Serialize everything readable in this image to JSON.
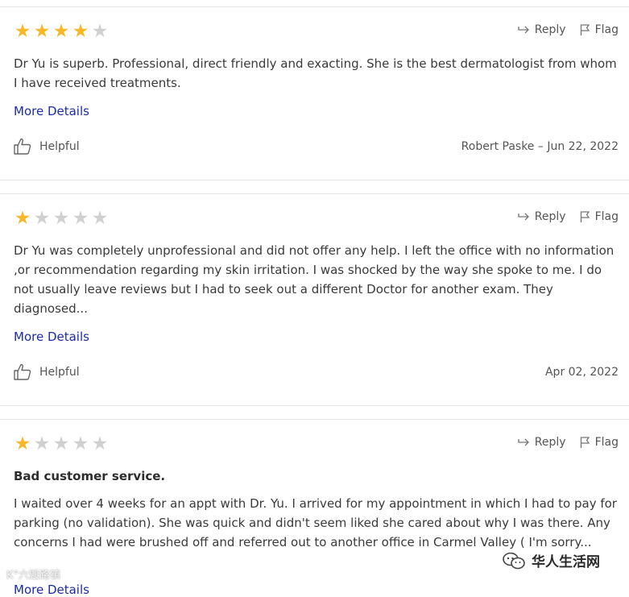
{
  "labels": {
    "reply": "Reply",
    "flag": "Flag",
    "more_details": "More Details",
    "helpful": "Helpful"
  },
  "colors": {
    "star_on": "#f7b92b",
    "star_off": "#d0d0d0",
    "link": "#1a2ca6"
  },
  "reviews": [
    {
      "rating": 4,
      "title": "",
      "text": "Dr Yu is superb. Professional, direct friendly and exacting. She is the best dermatologist from whom I have received treatments.",
      "author_date": "Robert Paske – Jun 22, 2022"
    },
    {
      "rating": 1,
      "title": "",
      "text": "Dr Yu was completely unprofessional and did not offer any help. I left the office with no information ,or recommendation regarding my skin irritation. I was shocked by the way she spoke to me. I do not usually leave reviews but I had to seek out a different Doctor for another exam. They diagnosed...",
      "author_date": "Apr 02, 2022"
    },
    {
      "rating": 1,
      "title": "Bad customer service.",
      "text": "I waited over 4 weeks for an appt with Dr. Yu. I arrived for my appointment in which I had to pay for parking (no validation). She was quick and didn't seem liked she cared about why I was there. Any concerns I had were brushed off and referred out to another office in Carmel Valley ( I'm sorry...",
      "author_date": ""
    }
  ],
  "watermarks": {
    "left": "K°六毁路镇",
    "right": "华人生活网"
  }
}
